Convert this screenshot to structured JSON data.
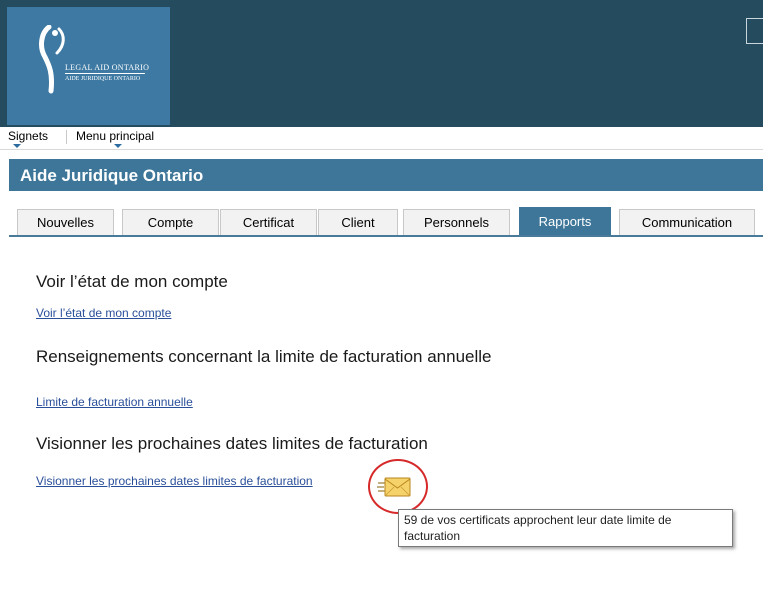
{
  "header": {
    "logo": {
      "line1": "Legal Aid Ontario",
      "line2": "Aide juridique Ontario"
    }
  },
  "menubar": {
    "items": [
      {
        "label": "Signets"
      },
      {
        "label": "Menu principal"
      }
    ]
  },
  "page_title": "Aide Juridique Ontario",
  "tabs": [
    {
      "label": "Nouvelles",
      "active": false
    },
    {
      "label": "Compte",
      "active": false
    },
    {
      "label": "Certificat",
      "active": false
    },
    {
      "label": "Client",
      "active": false
    },
    {
      "label": "Personnels",
      "active": false
    },
    {
      "label": "Rapports",
      "active": true
    },
    {
      "label": "Communication",
      "active": false
    }
  ],
  "sections": [
    {
      "heading": "Voir l’état de mon compte",
      "link": "Voir l’état de mon compte"
    },
    {
      "heading": "Renseignements concernant la limite de facturation annuelle",
      "link": "Limite de facturation annuelle"
    },
    {
      "heading": "Visionner les prochaines dates limites de facturation",
      "link": "Visionner les prochaines dates limites de facturation"
    }
  ],
  "notification": {
    "icon": "mail-notification-icon",
    "tooltip": "59 de vos certificats approchent leur date limite de facturation"
  },
  "colors": {
    "header_bg": "#254c5e",
    "logo_bg": "#3d79a2",
    "title_bar": "#3d7699",
    "active_tab": "#3d7699",
    "link": "#2a4f9a",
    "highlight_circle": "#d62a2a"
  }
}
